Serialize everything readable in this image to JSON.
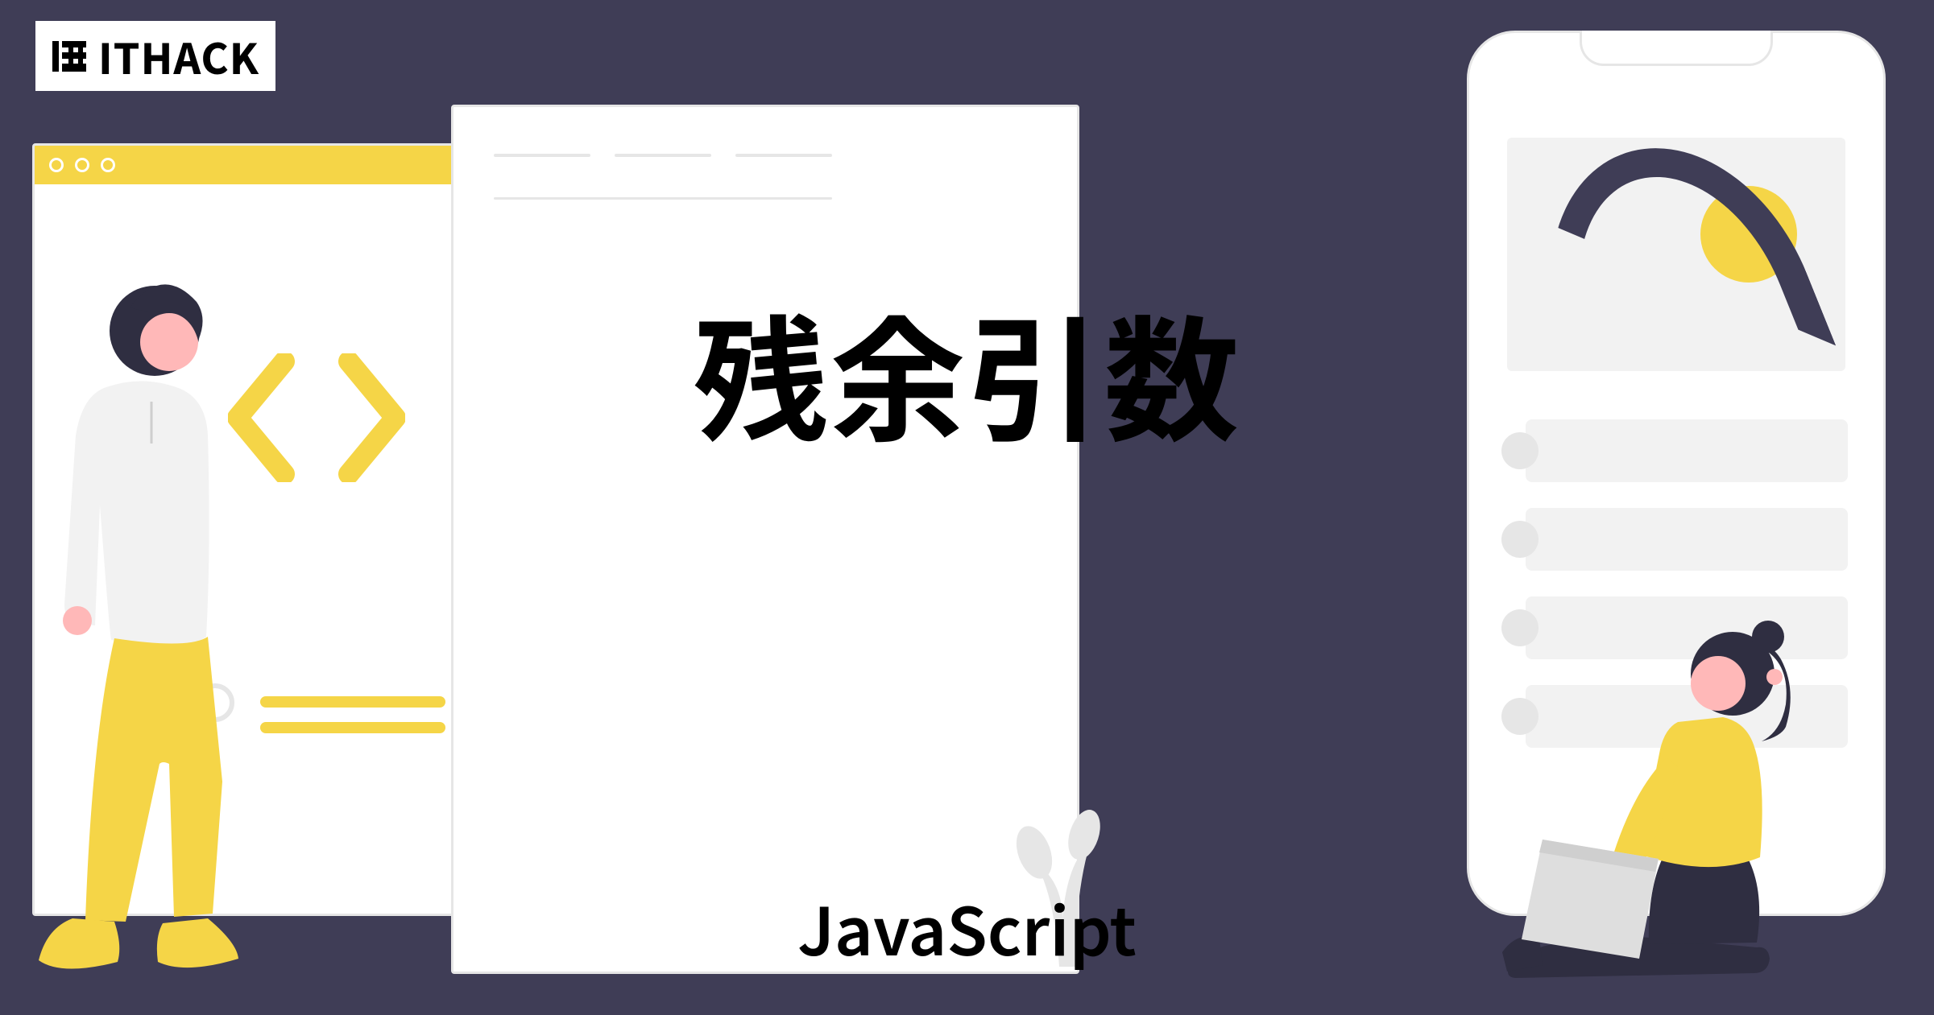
{
  "logo": {
    "text": "ITHACK",
    "icon_name": "ithack-logo-mark"
  },
  "headline": "残余引数",
  "subhead": "JavaScript",
  "colors": {
    "background": "#3f3d56",
    "accent": "#f5d547",
    "panel": "#ffffff",
    "subtle": "#e6e6e6",
    "skin": "#ffb8b8",
    "dark": "#2f2e41"
  },
  "elements": {
    "browser_dots": 3,
    "phone_cards": 4
  }
}
